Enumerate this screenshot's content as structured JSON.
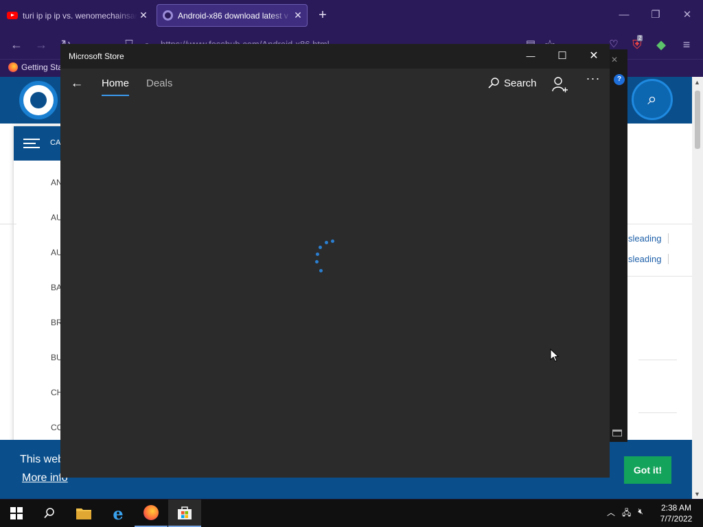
{
  "browser": {
    "tabs": [
      {
        "label": "turi ip ip ip vs. wenomechainsama",
        "icon": "youtube-icon"
      },
      {
        "label": "Android-x86 download latest v",
        "icon": "site-icon"
      }
    ],
    "url": "https://www.fosshub.com/Android-x86.html",
    "bookmark": "Getting Started",
    "ublock_badge": "2"
  },
  "webpage": {
    "category_header": "CA",
    "categories": [
      "AN",
      "AU",
      "AU",
      "BA",
      "BR",
      "BU",
      "CH",
      "CO"
    ],
    "misleading": [
      "sleading",
      "sleading"
    ],
    "cookie_text": "This web",
    "cookie_more_info": "More info",
    "cookie_button": "Got it!"
  },
  "store": {
    "title": "Microsoft Store",
    "tabs": {
      "home": "Home",
      "deals": "Deals"
    },
    "search_label": "Search",
    "more_label": "···",
    "loading": true,
    "accent": "#3b9bf0"
  },
  "taskbar": {
    "apps": [
      "start-button",
      "search",
      "file-explorer",
      "internet-explorer",
      "firefox",
      "microsoft-store"
    ],
    "time": "2:38 AM",
    "date": "7/7/2022"
  },
  "colors": {
    "browser_bg": "#2b1a5a",
    "site_blue": "#0a4f8c",
    "got_it_green": "#14a35a"
  }
}
